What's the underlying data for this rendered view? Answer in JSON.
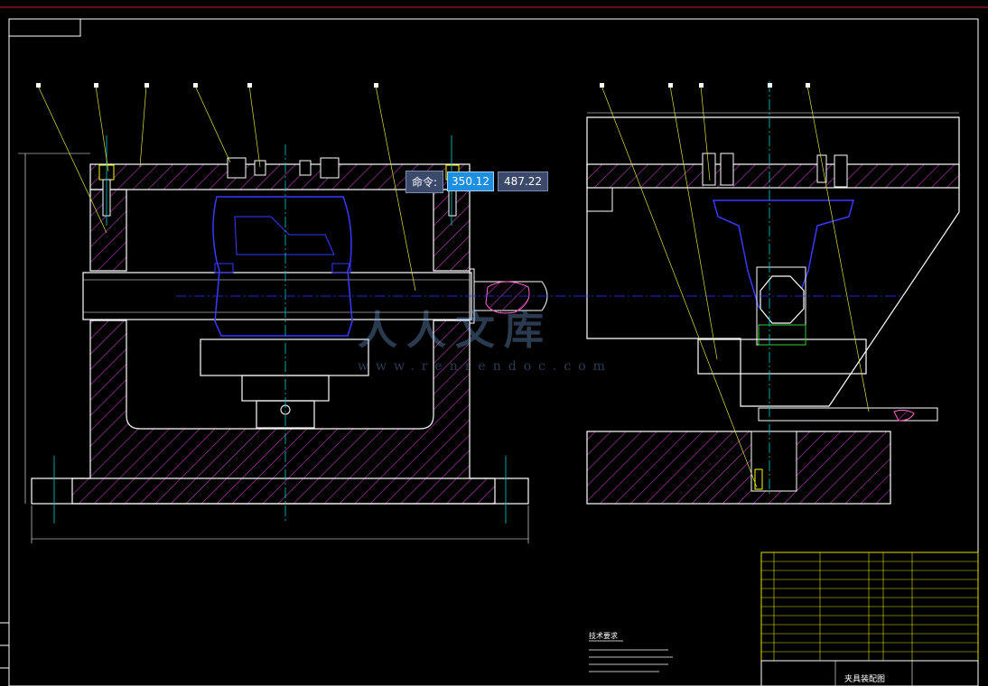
{
  "command_line": {
    "label": "命令:",
    "x_value": "350.12",
    "y_value": "487.22"
  },
  "watermark": {
    "text": "人人文库",
    "url": "www.renrendoc.com"
  },
  "title_block": {
    "drawing_name": "夹具装配图",
    "notes_title": "技术要求"
  },
  "colors": {
    "background": "#000000",
    "frame": "#ffffff",
    "hatch": "#cc33cc",
    "part": "#3333ff",
    "leader": "#ffff33",
    "centerline": "#00cccc",
    "title_block": "#ffff00"
  }
}
